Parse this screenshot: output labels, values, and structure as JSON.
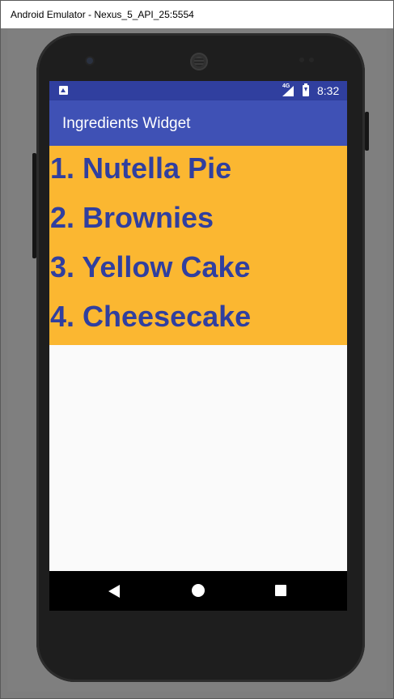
{
  "window": {
    "title": "Android Emulator - Nexus_5_API_25:5554"
  },
  "status_bar": {
    "network": "4G",
    "time": "8:32"
  },
  "app_bar": {
    "title": "Ingredients Widget"
  },
  "widget": {
    "items": [
      "1. Nutella Pie",
      "2. Brownies",
      "3. Yellow Cake",
      "4. Cheesecake"
    ]
  },
  "colors": {
    "status_bar": "#303f9f",
    "app_bar": "#3f51b5",
    "widget_background": "#fbb731",
    "widget_text": "#303f9f"
  },
  "icons": {
    "status_left": "notification-icon",
    "signal": "signal-icon",
    "battery": "battery-charging-icon",
    "back": "back-icon",
    "home": "home-icon",
    "recents": "recents-icon"
  }
}
